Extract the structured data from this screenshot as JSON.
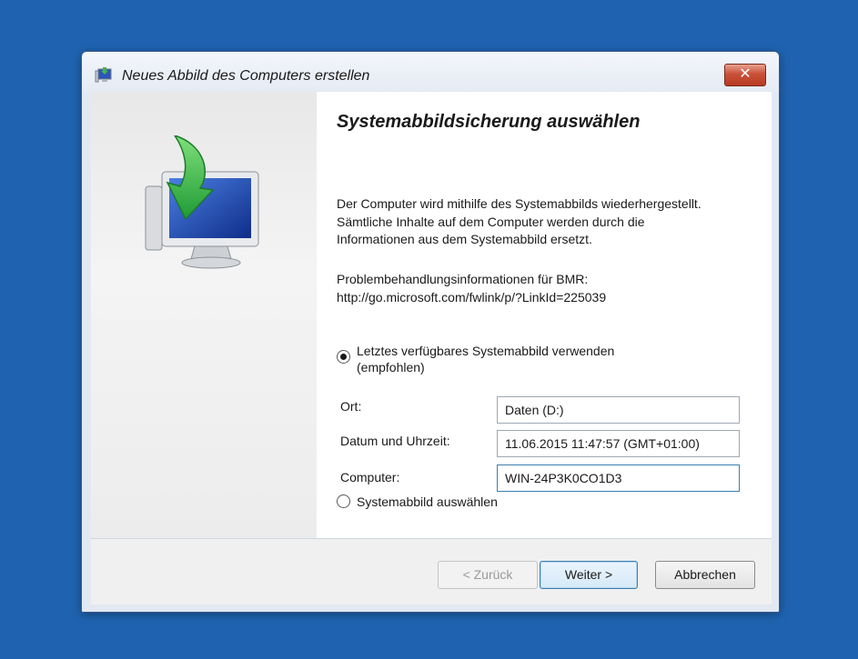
{
  "window": {
    "title": "Neues Abbild des Computers erstellen",
    "close_label": "✕"
  },
  "page": {
    "heading": "Systemabbildsicherung auswählen",
    "description": "Der Computer wird mithilfe des Systemabbilds wiederhergestellt. Sämtliche Inhalte auf dem Computer werden durch die Informationen aus dem Systemabbild ersetzt.",
    "troubleshoot_label": "Problembehandlungsinformationen für BMR:",
    "troubleshoot_url": "http://go.microsoft.com/fwlink/p/?LinkId=225039"
  },
  "options": {
    "latest_label": "Letztes verfügbares Systemabbild verwenden (empfohlen)",
    "latest_selected": true,
    "select_label": "Systemabbild auswählen",
    "select_selected": false
  },
  "fields": {
    "location_label": "Ort:",
    "location_value": "Daten (D:)",
    "datetime_label": "Datum und Uhrzeit:",
    "datetime_value": "11.06.2015 11:47:57 (GMT+01:00)",
    "computer_label": "Computer:",
    "computer_value": "WIN-24P3K0CO1D3"
  },
  "buttons": {
    "back": "< Zurück",
    "next": "Weiter >",
    "cancel": "Abbrechen"
  },
  "icons": {
    "title_icon": "system-image-backup-icon",
    "illustration": "monitor-restore-arrow-icon"
  },
  "colors": {
    "desktop": "#1f63b0",
    "close_button": "#c9513a",
    "focus_border": "#3c7fb1"
  }
}
